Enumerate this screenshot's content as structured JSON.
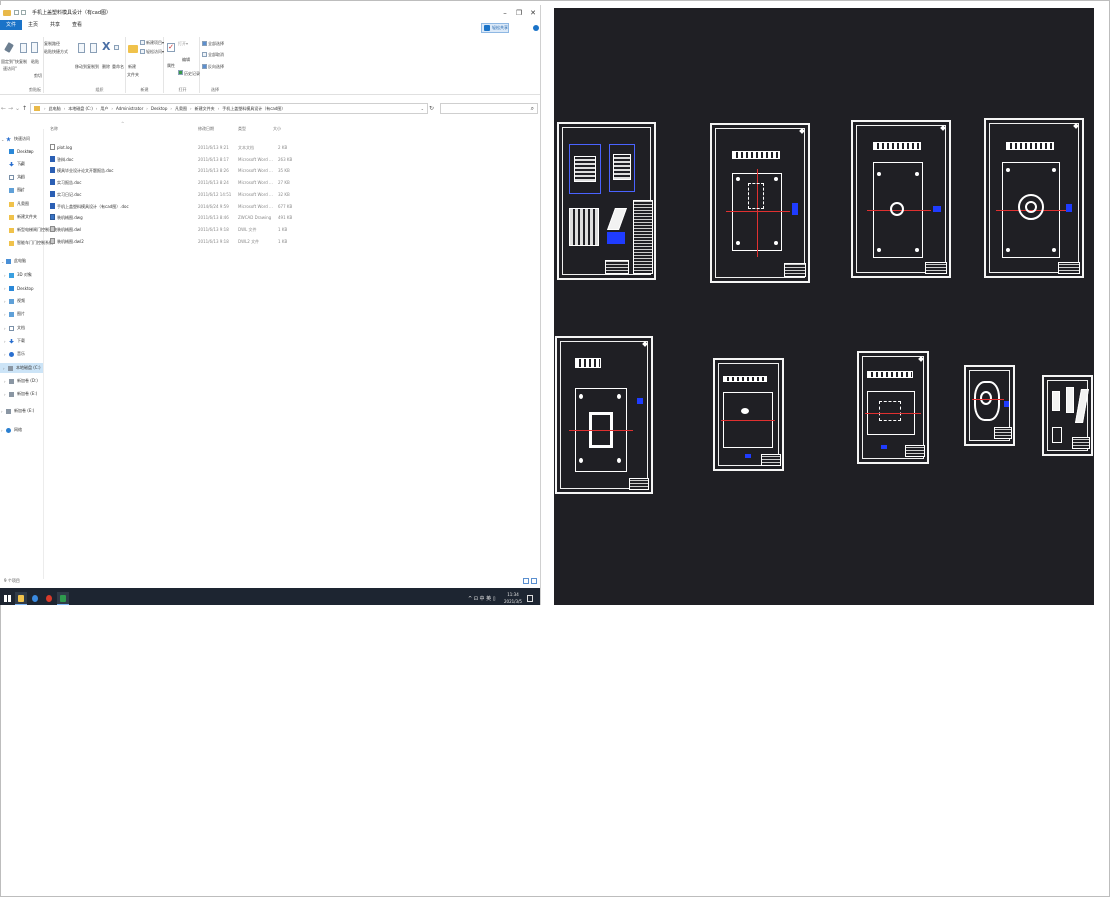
{
  "window": {
    "title": "手机上盖塑料模具设计（有cad图）",
    "minimize": "–",
    "maximize": "❐",
    "close": "✕"
  },
  "ribbon": {
    "tabs": [
      "文件",
      "主页",
      "共享",
      "查看"
    ],
    "share_button": "轻松共享",
    "clipboard": {
      "pin_label_1": "固定到\"快",
      "pin_label_2": "速访问\"",
      "copy_label": "复制",
      "paste_label": "粘贴",
      "copy_path": "复制路径",
      "paste_shortcut": "粘贴快捷方式",
      "cut": "剪切",
      "group": "剪贴板"
    },
    "organize": {
      "move_to": "移动到",
      "copy_to": "复制到",
      "delete": "删除",
      "rename": "重命名",
      "group": "组织"
    },
    "new": {
      "new_folder_1": "新建",
      "new_folder_2": "文件夹",
      "new_item": "新建项目▾",
      "easy_access": "轻松访问▾",
      "group": "新建"
    },
    "open": {
      "properties": "属性",
      "open": "打开▾",
      "edit": "编辑",
      "history": "历史记录",
      "group": "打开"
    },
    "select": {
      "select_all": "全部选择",
      "select_none": "全部取消",
      "invert": "反向选择",
      "group": "选择"
    }
  },
  "address": {
    "crumbs": [
      "此电脑",
      "本地磁盘 (C:)",
      "用户",
      "Administrator",
      "Desktop",
      "凡奥图",
      "新建文件夹",
      "手机上盖塑料模具设计（有cad图）"
    ],
    "dropdown": "⌄",
    "refresh": "↻",
    "search_icon": "⌕"
  },
  "nav": {
    "items": [
      {
        "label": "快速访问",
        "icon": "star-icon",
        "kind": "star",
        "indent": 0,
        "chev": "⌄"
      },
      {
        "label": "Desktop",
        "icon": "desktop-icon",
        "kind": "blue",
        "indent": 1,
        "pin": "✱"
      },
      {
        "label": "下载",
        "icon": "download-icon",
        "kind": "down",
        "indent": 1,
        "pin": "✱"
      },
      {
        "label": "文档",
        "icon": "documents-icon",
        "kind": "doc",
        "indent": 1,
        "pin": "✱"
      },
      {
        "label": "图片",
        "icon": "pictures-icon",
        "kind": "pic",
        "indent": 1,
        "pin": "✱"
      },
      {
        "label": "凡奥图",
        "icon": "folder-icon",
        "kind": "folder",
        "indent": 1
      },
      {
        "label": "新建文件夹",
        "icon": "folder-icon",
        "kind": "folder",
        "indent": 1
      },
      {
        "label": "新型电梯闸门控制系统",
        "icon": "folder-icon",
        "kind": "folder",
        "indent": 1
      },
      {
        "label": "智能车门门控制系统",
        "icon": "folder-icon",
        "kind": "folder",
        "indent": 1
      },
      {
        "label": "此电脑",
        "icon": "computer-icon",
        "kind": "pc",
        "indent": 0,
        "chev": "⌄"
      },
      {
        "label": "3D 对象",
        "icon": "3d-objects-icon",
        "kind": "cube",
        "indent": 1,
        "chev": "›"
      },
      {
        "label": "Desktop",
        "icon": "desktop-icon",
        "kind": "blue",
        "indent": 1,
        "chev": "›"
      },
      {
        "label": "视频",
        "icon": "video-icon",
        "kind": "pic",
        "indent": 1,
        "chev": "›"
      },
      {
        "label": "图片",
        "icon": "pictures-icon",
        "kind": "pic",
        "indent": 1,
        "chev": "›"
      },
      {
        "label": "文档",
        "icon": "documents-icon",
        "kind": "doc",
        "indent": 1,
        "chev": "›"
      },
      {
        "label": "下载",
        "icon": "download-icon",
        "kind": "down",
        "indent": 1,
        "chev": "›"
      },
      {
        "label": "音乐",
        "icon": "music-icon",
        "kind": "music",
        "indent": 1,
        "chev": "›"
      },
      {
        "label": "本地磁盘 (C:)",
        "icon": "drive-icon",
        "kind": "drive",
        "indent": 1,
        "chev": "›",
        "selected": true
      },
      {
        "label": "新加卷 (D:)",
        "icon": "drive-icon",
        "kind": "drive",
        "indent": 1,
        "chev": "›"
      },
      {
        "label": "新加卷 (E:)",
        "icon": "drive-icon",
        "kind": "drive",
        "indent": 1,
        "chev": "›"
      },
      {
        "label": "新加卷 (E:)",
        "icon": "drive-icon",
        "kind": "drive",
        "indent": 0,
        "chev": "›"
      },
      {
        "label": "网络",
        "icon": "network-icon",
        "kind": "net",
        "indent": 0,
        "chev": "›"
      }
    ]
  },
  "files": {
    "headers": {
      "name": "名称",
      "date": "修改日期",
      "type": "类型",
      "size": "大小",
      "sort": "^"
    },
    "rows": [
      {
        "name": "plot.log",
        "date": "2011/6/13 9:21",
        "type": "文本文档",
        "size": "2 KB",
        "icon": "txt"
      },
      {
        "name": "答辩.doc",
        "date": "2011/6/13 8:17",
        "type": "Microsoft Word ...",
        "size": "263 KB",
        "icon": "word"
      },
      {
        "name": "模具毕业设计论文开题报告.doc",
        "date": "2011/6/13 8:26",
        "type": "Microsoft Word ...",
        "size": "35 KB",
        "icon": "word"
      },
      {
        "name": "实习报告.doc",
        "date": "2011/6/13 8:24",
        "type": "Microsoft Word ...",
        "size": "27 KB",
        "icon": "word"
      },
      {
        "name": "实习日记.doc",
        "date": "2011/6/12 14:51",
        "type": "Microsoft Word ...",
        "size": "32 KB",
        "icon": "word"
      },
      {
        "name": "手机上盖塑料模具设计（有cad图）.doc",
        "date": "2014/6/24 9:59",
        "type": "Microsoft Word ...",
        "size": "677 KB",
        "icon": "word"
      },
      {
        "name": "装机械图.dwg",
        "date": "2011/6/13 8:46",
        "type": "ZWCAD Drawing",
        "size": "491 KB",
        "icon": "zw"
      },
      {
        "name": "装机械图.dwl",
        "date": "2011/6/13 9:18",
        "type": "DWL 文件",
        "size": "1 KB",
        "icon": "dwg"
      },
      {
        "name": "装机械图.dwl2",
        "date": "2011/6/13 9:18",
        "type": "DWL2 文件",
        "size": "1 KB",
        "icon": "dwg"
      }
    ]
  },
  "status": {
    "count": "9 个项目"
  },
  "taskbar": {
    "tray": "^ ⊡ 中 英 ▯",
    "time": "11:34",
    "date": "2021/3/5"
  },
  "colors": {
    "accent": "#1a73c8",
    "cad_background": "#1f1f24",
    "cad_redline": "#e03030",
    "cad_bluemark": "#1f3cff"
  }
}
